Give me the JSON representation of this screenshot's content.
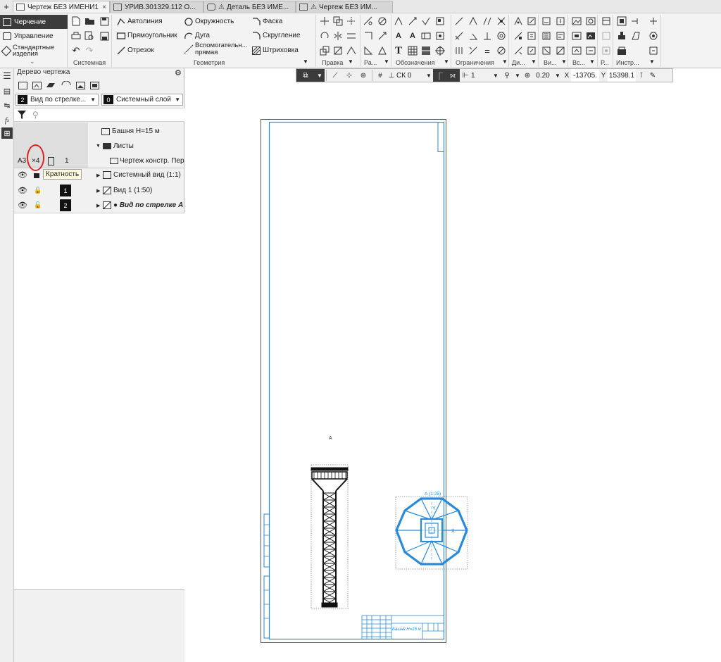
{
  "tabs": [
    {
      "label": "Чертеж БЕЗ ИМЕНИ1",
      "active": true
    },
    {
      "label": "УРИВ.301329.112 О...",
      "active": false
    },
    {
      "label": "Деталь БЕЗ ИМЕ...",
      "active": false
    },
    {
      "label": "Чертеж БЕЗ ИМ...",
      "active": false
    }
  ],
  "modes": [
    {
      "label": "Черчение",
      "active": true
    },
    {
      "label": "Управление",
      "active": false
    },
    {
      "label": "Стандартные изделия",
      "active": false
    }
  ],
  "ribbon": {
    "groups": {
      "system": "Системная",
      "geometry": "Геометрия",
      "edit": "Правка",
      "ra": "Ра...",
      "notation": "Обозначения",
      "constraints": "Ограничения",
      "di": "Ди...",
      "vi": "Ви...",
      "vs": "Вс...",
      "r": "Р...",
      "instr": "Инстр..."
    },
    "geometry_buttons": {
      "autoline": "Автолиния",
      "rectangle": "Прямоугольник",
      "segment": "Отрезок",
      "circle": "Окружность",
      "arc": "Дуга",
      "auxline": "Вспомогательн... прямая",
      "chamfer": "Фаска",
      "fillet": "Скругление",
      "hatch": "Штриховка"
    }
  },
  "tree": {
    "title": "Дерево чертежа",
    "view_select": {
      "number": "2",
      "label": "Вид по стрелке..."
    },
    "layer_select": {
      "number": "0",
      "label": "Системный слой"
    },
    "header_rows": {
      "root": "Башня Н=15 м",
      "sheets": "Листы",
      "format": "А3",
      "multiplicity": "×4",
      "sheet_num": "1",
      "sheet": "Чертеж констр. Перв"
    },
    "tooltip": "Кратность",
    "views": [
      {
        "label": "Системный вид (1:1)",
        "number": ""
      },
      {
        "label": "Вид 1 (1:50)",
        "number": "1"
      },
      {
        "label": "● Вид по стрелке А (",
        "number": "2"
      }
    ]
  },
  "drawbar": {
    "cs": "СК 0",
    "layer": "1",
    "zoom": "0.20",
    "x_label": "X",
    "x_value": "-13705.",
    "y_label": "Y",
    "y_value": "15398.1"
  },
  "drawing": {
    "view_label": "А (1:25)",
    "axis_x": "X",
    "axis_y": "Y",
    "arrow_label": "А",
    "title_block_text": "Башня Н=15 м"
  },
  "colors": {
    "frame": "#2a8ad8",
    "accent_dark": "#3b3b3b",
    "annotation_red": "#e0201c"
  }
}
